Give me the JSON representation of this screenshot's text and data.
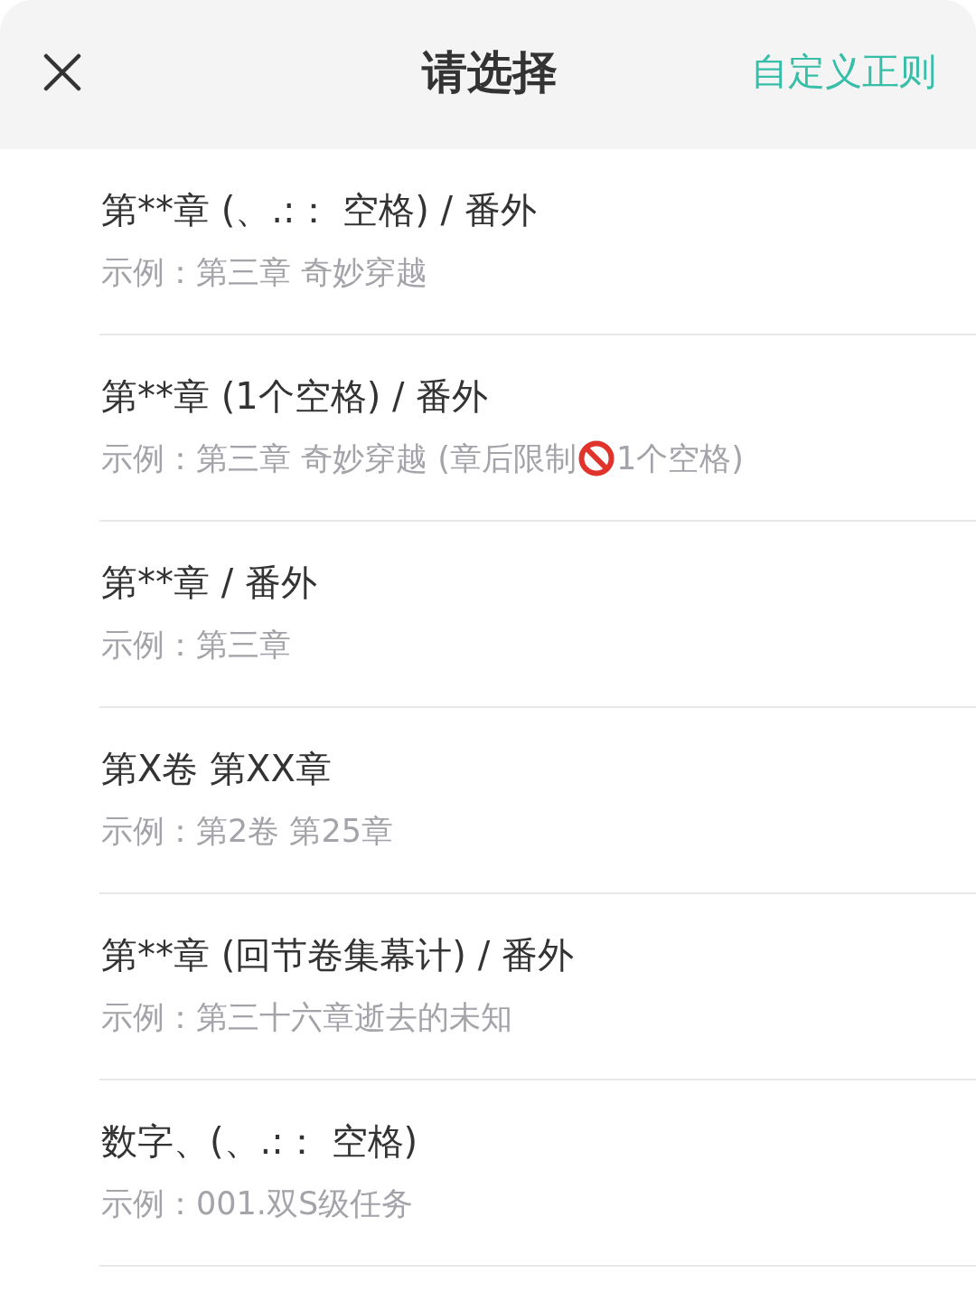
{
  "header": {
    "title": "请选择",
    "action": "自定义正则"
  },
  "options": [
    {
      "title": "第**章 (、.:： 空格) / 番外",
      "example": [
        {
          "kind": "text",
          "text": "示例：第三章 奇妙穿越"
        }
      ]
    },
    {
      "title": "第**章 (1个空格) / 番外",
      "example": [
        {
          "kind": "text",
          "text": "示例：第三章 奇妙穿越 (章后限制"
        },
        {
          "kind": "icon"
        },
        {
          "kind": "text",
          "text": "1个空格)"
        }
      ]
    },
    {
      "title": "第**章 / 番外",
      "example": [
        {
          "kind": "text",
          "text": "示例：第三章"
        }
      ]
    },
    {
      "title": "第X卷 第XX章",
      "example": [
        {
          "kind": "text",
          "text": "示例：第2卷 第25章"
        }
      ]
    },
    {
      "title": "第**章 (回节卷集幕计) / 番外",
      "example": [
        {
          "kind": "text",
          "text": "示例：第三十六章逝去的未知"
        }
      ]
    },
    {
      "title": "数字、(、.:： 空格)",
      "example": [
        {
          "kind": "text",
          "text": "示例：001.双S级任务"
        }
      ]
    }
  ]
}
